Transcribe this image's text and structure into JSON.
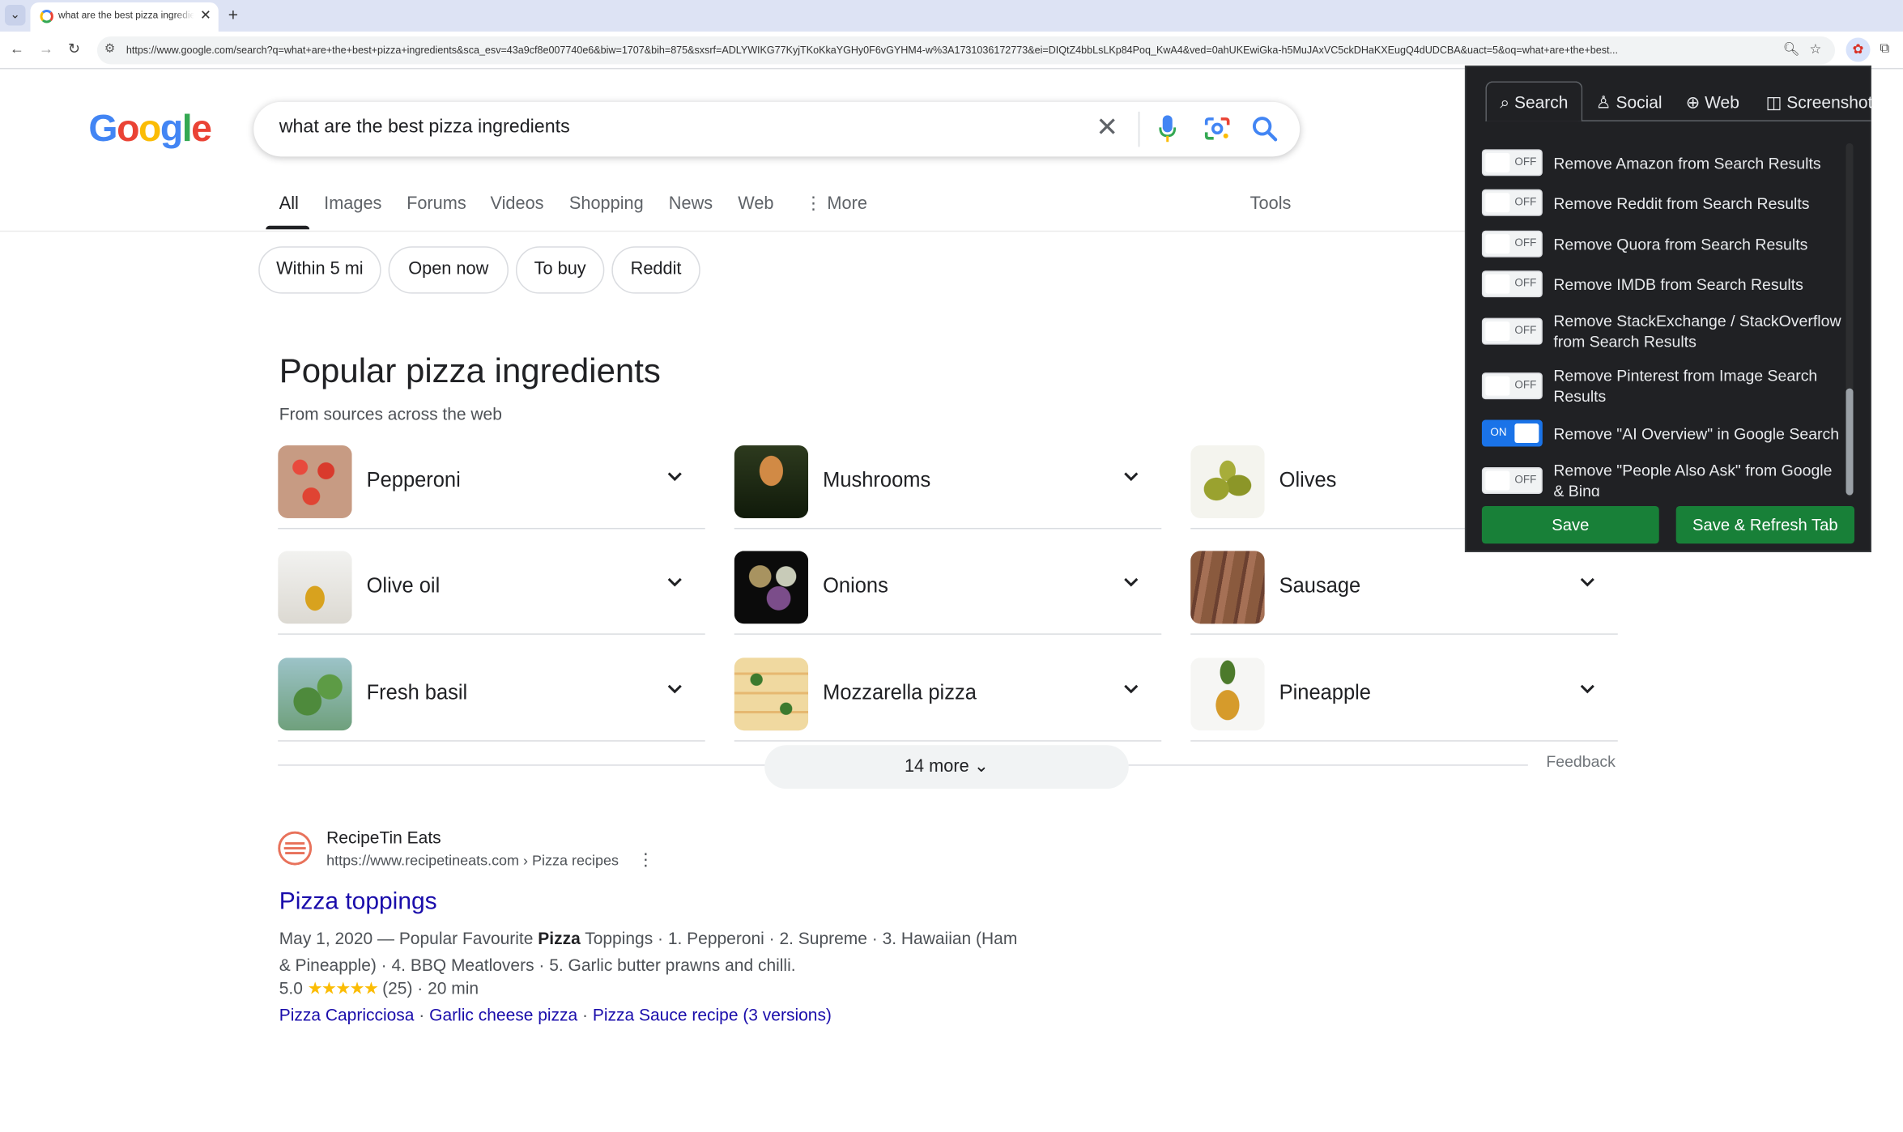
{
  "browser": {
    "tab_title": "what are the best pizza ingredients",
    "url": "https://www.google.com/search?q=what+are+the+best+pizza+ingredients&sca_esv=43a9cf8e007740e6&biw=1707&bih=875&sxsrf=ADLYWIKG77KyjTKoKkaYGHy0F6vGYHM4-w%3A1731036172773&ei=DIQtZ4bbLsLKp84Poq_KwA4&ved=0ahUKEwiGka-h5MuJAxVC5ckDHaKXEugQ4dUDCBA&uact=5&oq=what+are+the+best..."
  },
  "search": {
    "query": "what are the best pizza ingredients"
  },
  "nav": {
    "tabs": [
      "All",
      "Images",
      "Forums",
      "Videos",
      "Shopping",
      "News",
      "Web",
      "More"
    ],
    "tools": "Tools"
  },
  "chips": [
    "Within 5 mi",
    "Open now",
    "To buy",
    "Reddit"
  ],
  "ingredients": {
    "title": "Popular pizza ingredients",
    "subtitle": "From sources across the web",
    "items": [
      "Pepperoni",
      "Mushrooms",
      "Olives",
      "Olive oil",
      "Onions",
      "Sausage",
      "Fresh basil",
      "Mozzarella pizza",
      "Pineapple"
    ],
    "more": "14 more",
    "feedback": "Feedback"
  },
  "result": {
    "site_name": "RecipeTin Eats",
    "site_url": "https://www.recipetineats.com › Pizza recipes",
    "title": "Pizza toppings",
    "snippet_pre": "May 1, 2020 — Popular Favourite ",
    "snippet_bold": "Pizza",
    "snippet_post": " Toppings · 1. Pepperoni · 2. Supreme · 3. Hawaiian (Ham & Pineapple) · 4. BBQ Meatlovers · 5. Garlic butter prawns and chilli.",
    "rating_value": "5.0",
    "rating_stars": "★★★★★",
    "rating_meta": "(25) · 20 min",
    "sitelinks": [
      "Pizza Capricciosa",
      "Garlic cheese pizza",
      "Pizza Sauce recipe (3 versions)"
    ]
  },
  "popup": {
    "tabs": [
      "Search",
      "Social",
      "Web",
      "Screenshot"
    ],
    "options": [
      {
        "label": "Remove Amazon from Search Results",
        "state": "OFF"
      },
      {
        "label": "Remove Reddit from Search Results",
        "state": "OFF"
      },
      {
        "label": "Remove Quora from Search Results",
        "state": "OFF"
      },
      {
        "label": "Remove IMDB from Search Results",
        "state": "OFF"
      },
      {
        "label": "Remove StackExchange / StackOverflow from Search Results",
        "state": "OFF"
      },
      {
        "label": "Remove Pinterest from Image Search Results",
        "state": "OFF"
      },
      {
        "label": "Remove \"AI Overview\" in Google Search",
        "state": "ON"
      },
      {
        "label": "Remove \"People Also Ask\" from Google & Bing",
        "state": "OFF"
      }
    ],
    "save": "Save",
    "save_refresh": "Save & Refresh Tab"
  },
  "colors": {
    "google_blue": "#4285f4",
    "google_red": "#ea4335",
    "google_yellow": "#fbbc05",
    "google_green": "#34a853",
    "link": "#1a0dab",
    "popup_bg": "#202124",
    "save_green": "#188038"
  },
  "icons": [
    "chevron-down-icon",
    "close-icon",
    "plus-icon",
    "back-icon",
    "forward-icon",
    "reload-icon",
    "site-info-icon",
    "zoom-icon",
    "star-icon",
    "extension-icon",
    "puzzle-icon",
    "mic-icon",
    "lens-icon",
    "search-icon",
    "kebab-icon"
  ]
}
